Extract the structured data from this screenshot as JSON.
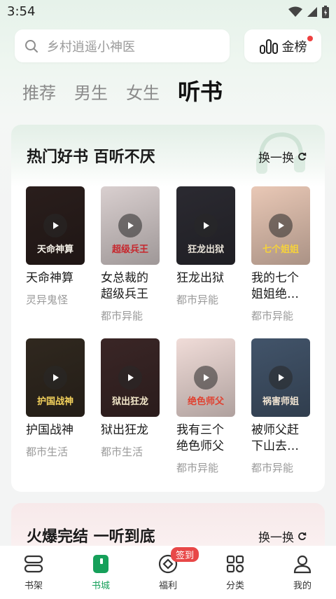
{
  "status_bar": {
    "time": "3:54"
  },
  "search": {
    "placeholder": "乡村逍遥小神医"
  },
  "rank": {
    "label": "金榜"
  },
  "tabs": [
    {
      "label": "推荐",
      "active": false
    },
    {
      "label": "男生",
      "active": false
    },
    {
      "label": "女生",
      "active": false
    },
    {
      "label": "听书",
      "active": true
    }
  ],
  "section1": {
    "title": "热门好书 百听不厌",
    "refresh_label": "换一换",
    "books": [
      {
        "title": "天命神算",
        "category": "灵异鬼怪",
        "cover_text": "天命神算",
        "cover_bg": "#2a1e1c",
        "cover_text_color": "#f3efe6"
      },
      {
        "title": "女总裁的超级兵王",
        "category": "都市异能",
        "cover_text": "超级兵王",
        "cover_bg": "#d9cfcf",
        "cover_text_color": "#c7262c"
      },
      {
        "title": "狂龙出狱",
        "category": "都市异能",
        "cover_text": "狂龙出狱",
        "cover_bg": "#2b2a31",
        "cover_text_color": "#e9e3d8"
      },
      {
        "title": "我的七个姐姐绝…",
        "category": "都市异能",
        "cover_text": "七个姐姐",
        "cover_bg": "#e9c8b6",
        "cover_text_color": "#f6d23a"
      },
      {
        "title": "护国战神",
        "category": "都市生活",
        "cover_text": "护国战神",
        "cover_bg": "#30281f",
        "cover_text_color": "#f4d25c"
      },
      {
        "title": "狱出狂龙",
        "category": "都市生活",
        "cover_text": "狱出狂龙",
        "cover_bg": "#3a2626",
        "cover_text_color": "#f2e7c9"
      },
      {
        "title": "我有三个绝色师父",
        "category": "都市异能",
        "cover_text": "绝色师父",
        "cover_bg": "#f0dcd8",
        "cover_text_color": "#e0402f"
      },
      {
        "title": "被师父赶下山去…",
        "category": "都市异能",
        "cover_text": "祸害师姐",
        "cover_bg": "#42546a",
        "cover_text_color": "#f1e4d2"
      }
    ]
  },
  "section2": {
    "title": "火爆完结 一听到底",
    "refresh_label": "换一换"
  },
  "bottom_nav": [
    {
      "label": "书架",
      "icon": "bookshelf-icon",
      "active": false
    },
    {
      "label": "书城",
      "icon": "bookstore-icon",
      "active": true
    },
    {
      "label": "福利",
      "icon": "welfare-icon",
      "active": false,
      "badge": "签到"
    },
    {
      "label": "分类",
      "icon": "category-icon",
      "active": false
    },
    {
      "label": "我的",
      "icon": "profile-icon",
      "active": false
    }
  ],
  "colors": {
    "accent": "#16a05a",
    "badge": "#e84848"
  }
}
